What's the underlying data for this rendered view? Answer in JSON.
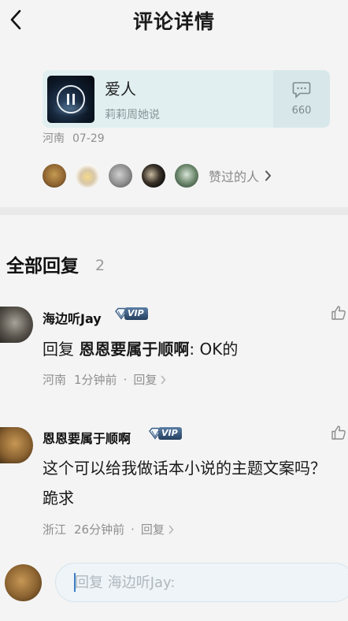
{
  "header": {
    "title": "评论详情"
  },
  "song": {
    "title": "爱人",
    "artist": "莉莉周她说",
    "comment_count": "660"
  },
  "comment_meta": {
    "location": "河南",
    "date": "07-29"
  },
  "likers": {
    "label": "赞过的人"
  },
  "replies_section": {
    "title": "全部回复",
    "count": "2"
  },
  "replies": [
    {
      "username": "海边听Jay",
      "vip": "VIP",
      "body_prefix": "回复 ",
      "mention": "恩恩要属于顺啊",
      "body_rest": ": OK的",
      "location": "河南",
      "time": "1分钟前",
      "reply_label": "回复"
    },
    {
      "username": "恩恩要属于顺啊",
      "vip": "VIP",
      "body": "这个可以给我做话本小说的主题文案吗？跪求",
      "location": "浙江",
      "time": "26分钟前",
      "reply_label": "回复"
    }
  ],
  "input": {
    "placeholder": "回复 海边听Jay:"
  }
}
